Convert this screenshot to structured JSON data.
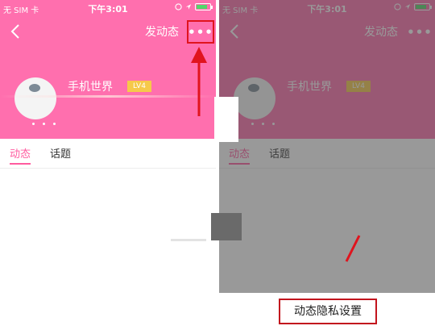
{
  "status_bar": {
    "carrier": "无 SIM 卡",
    "time": "下午3:01"
  },
  "header": {
    "post_label": "发动态",
    "more_label": "•••"
  },
  "profile": {
    "username": "手机世界",
    "level": "LV4"
  },
  "tabs": [
    {
      "label": "动态",
      "active": true
    },
    {
      "label": "话题",
      "active": false
    }
  ],
  "menu": {
    "privacy_label": "动态隐私设置"
  },
  "colors": {
    "header_pink": "#ff6fae",
    "accent_pink": "#ff5b9f",
    "highlight_red": "#e0141e"
  }
}
